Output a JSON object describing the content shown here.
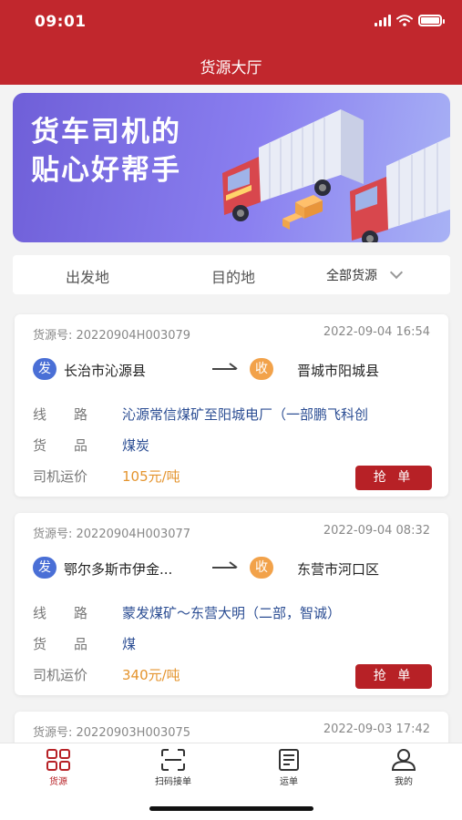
{
  "status_bar": {
    "time": "09:01"
  },
  "header": {
    "title": "货源大厅"
  },
  "banner": {
    "line1": "货车司机的",
    "line2": "贴心好帮手"
  },
  "filter": {
    "origin": "出发地",
    "destination": "目的地",
    "cargo_type": "全部货源"
  },
  "cards": [
    {
      "id_label": "货源号: 20220904H003079",
      "time": "2022-09-04 16:54",
      "from_badge": "发",
      "from": "长治市沁源县",
      "to_badge": "收",
      "to": "晋城市阳城县",
      "route_label": "线　　路",
      "route": "沁源常信煤矿至阳城电厂（一部鹏飞科创",
      "goods_label": "货　　品",
      "goods": "煤炭",
      "price_label": "司机运价",
      "price": "105元/吨",
      "grab": "抢 单"
    },
    {
      "id_label": "货源号: 20220904H003077",
      "time": "2022-09-04 08:32",
      "from_badge": "发",
      "from": "鄂尔多斯市伊金...",
      "to_badge": "收",
      "to": "东营市河口区",
      "route_label": "线　　路",
      "route": "蒙发煤矿～东营大明（二部，智诚）",
      "goods_label": "货　　品",
      "goods": "煤",
      "price_label": "司机运价",
      "price": "340元/吨",
      "grab": "抢 单"
    },
    {
      "id_label": "货源号: 20220903H003075",
      "time": "2022-09-03 17:42"
    }
  ],
  "tabbar": [
    {
      "label": "货源",
      "icon": "grid-icon",
      "active": true
    },
    {
      "label": "扫码接单",
      "icon": "scan-icon",
      "active": false
    },
    {
      "label": "运单",
      "icon": "document-icon",
      "active": false
    },
    {
      "label": "我的",
      "icon": "user-icon",
      "active": false
    }
  ],
  "colors": {
    "brand": "#c1272d",
    "button": "#b72126",
    "price": "#e4942e",
    "link": "#2b4d93",
    "from_badge": "#4a6fd6",
    "to_badge": "#f2a24a"
  }
}
